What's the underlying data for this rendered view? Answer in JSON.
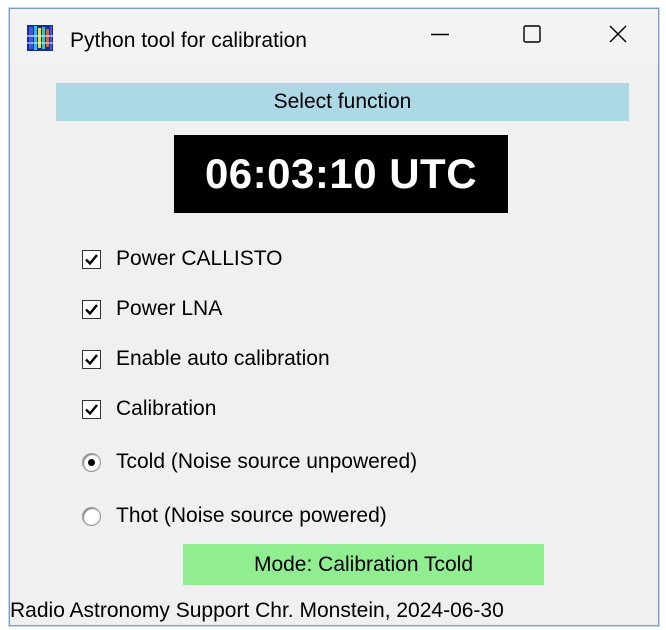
{
  "window": {
    "title": "Python tool for calibration",
    "app_icon": "spectrogram-icon",
    "controls": [
      "minimize-icon",
      "maximize-icon",
      "close-icon"
    ]
  },
  "header": {
    "select_function_label": "Select function"
  },
  "clock": {
    "time_text": "06:03:10 UTC"
  },
  "options": [
    {
      "type": "checkbox",
      "label": "Power CALLISTO",
      "checked": true
    },
    {
      "type": "checkbox",
      "label": "Power LNA",
      "checked": true
    },
    {
      "type": "checkbox",
      "label": "Enable auto calibration",
      "checked": true
    },
    {
      "type": "checkbox",
      "label": "Calibration",
      "checked": true
    },
    {
      "type": "radio",
      "label": "Tcold (Noise source unpowered)",
      "checked": true
    },
    {
      "type": "radio",
      "label": "Thot (Noise source powered)",
      "checked": false
    }
  ],
  "status": {
    "mode_text": "Mode: Calibration Tcold"
  },
  "footer": {
    "text": "Radio Astronomy Support Chr. Monstein, 2024-06-30"
  },
  "colors": {
    "select_function_bg": "#add8e6",
    "clock_bg": "#000000",
    "clock_fg": "#ffffff",
    "mode_bg": "#90ee90",
    "window_bg": "#f0f0f0"
  }
}
